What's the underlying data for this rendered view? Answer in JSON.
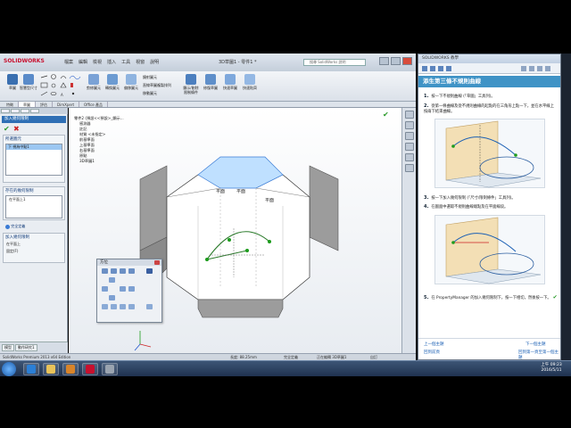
{
  "solidworks": {
    "brand": "SOLIDWORKS",
    "menu": [
      "檔案",
      "編輯",
      "檢視",
      "插入",
      "工具",
      "視窗",
      "說明"
    ],
    "doc_title": "3D草圖1 - 零件1 *",
    "search_placeholder": "搜尋 SolidWorks 說明",
    "command_tabs": [
      "特徵",
      "草圖",
      "評估",
      "DimXpert",
      "Office 產品"
    ],
    "tools": [
      "草圖",
      "智慧型尺寸",
      "剪修圖元",
      "轉換圖元",
      "偏移圖元",
      "鏡射圖元",
      "線性草圖複製排列",
      "顯示/刪除限制條件",
      "修復草圖",
      "快速草圖",
      "快速貼齊"
    ],
    "small_tools": [
      "鏡射圖元",
      "直線草圖複製排列",
      "移動圖元"
    ]
  },
  "property_manager": {
    "header": "加入幾何限制",
    "groups": [
      {
        "title": "所選圖元",
        "items": [
          "下 視為中點1"
        ]
      },
      {
        "title": "存在的幾何限制",
        "items": [
          "在平面上1"
        ]
      },
      {
        "title": "加入幾何限制",
        "items": [
          "在平面上",
          "固定(F)"
        ]
      }
    ],
    "info_label": "完全定義",
    "status_tabs": [
      "模型",
      "動作研究1"
    ]
  },
  "graphics": {
    "breadcrumb": "零件2 (預設<<預設>_顯示...",
    "tree": [
      "零件2 (預設<<預設>_顯示...",
      "感測器",
      "註記",
      "材質 <未指定>",
      "前基準面",
      "上基準面",
      "右基準面",
      "原點",
      "3D草圖1"
    ],
    "labels": [
      "平面",
      "平面",
      "平面"
    ]
  },
  "palette": {
    "title": "方位"
  },
  "status_bar": {
    "edition": "SolidWorks Premium 2013 x64 Edition",
    "values": [
      "長度: 88.25mm",
      "完全定義",
      "正在編輯 3D草圖1",
      "自訂"
    ]
  },
  "help": {
    "window_title": "SOLIDWORKS 教學",
    "heading": "添生第三條不規則曲線",
    "steps": [
      {
        "n": "1.",
        "text": "按一下不規則曲線 (「草圖」工具列)。"
      },
      {
        "n": "2.",
        "text": "從第一條曲線及從不規則曲線的起點的在三角形上點一下，並在水平線上按兩下結束曲線。"
      },
      {
        "n": "3.",
        "text": "按一下加入幾何限制 (「尺寸/限制條件」工具列)。"
      },
      {
        "n": "4.",
        "text": "在圖面中選取不規則曲線端點及在平面線段。"
      },
      {
        "n": "5.",
        "text": "在 PropertyManager 的加入幾何限制下，按一下相切，然後按一下。"
      }
    ],
    "nav": {
      "prev": "上一個主題",
      "next": "下一個主題",
      "prev_sub": "回到前頁",
      "next_sub": "回到第一頁至第一個主題"
    }
  },
  "taskbar": {
    "time": "上午 09:23",
    "date": "2016/5/11"
  },
  "colors": {
    "accent": "#2f6fb5",
    "help_header": "#3f93c6",
    "selection_blue": "#bfe0ff",
    "model_gray": "#a0a0a0"
  }
}
